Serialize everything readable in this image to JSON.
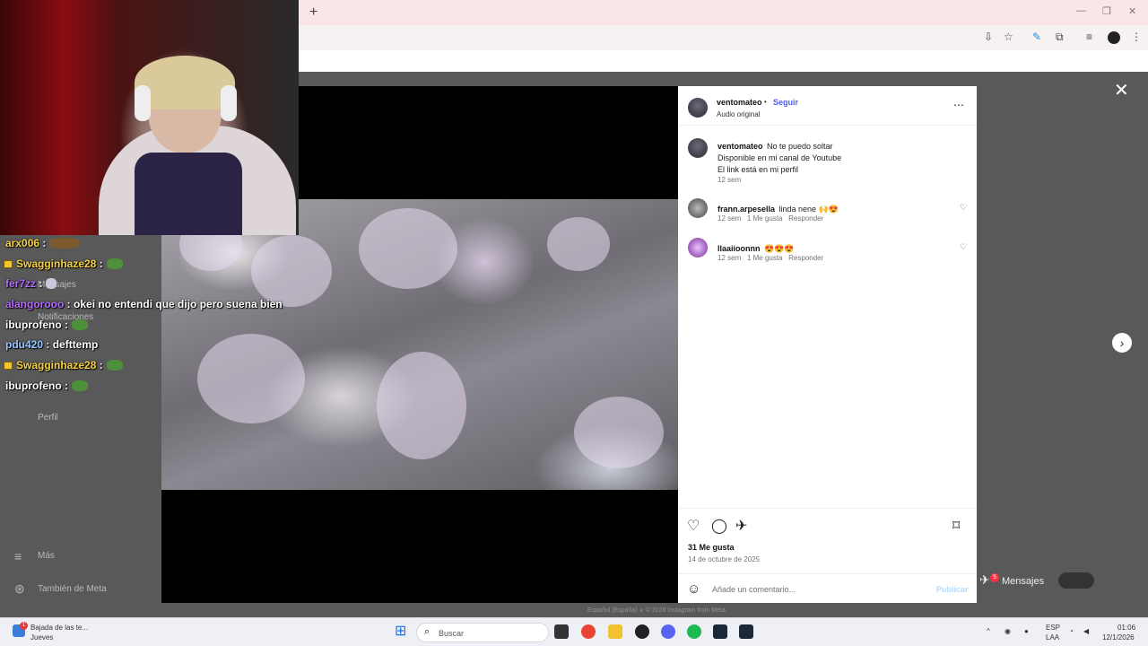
{
  "browser": {
    "new_tab": "+",
    "minimize": "—",
    "restore": "❐",
    "close": "✕"
  },
  "post": {
    "username": "ventomateo",
    "follow_label": "Seguir",
    "separator": "•",
    "audio": "Audio original",
    "caption_lines": [
      "No te puedo soltar",
      "Disponible en mi canal de Youtube",
      "El link está en mi perfil"
    ],
    "caption_time": "12 sem",
    "likes": "31 Me gusta",
    "date": "14 de octubre de 2025",
    "comment_placeholder": "Añade un comentario...",
    "publish_label": "Publicar"
  },
  "comments": [
    {
      "user": "frann.arpesella",
      "text": "linda nene 🙌😍",
      "time": "12 sem",
      "likes": "1 Me gusta",
      "reply": "Responder"
    },
    {
      "user": "llaaiioonnn",
      "text": "😍😍😍",
      "time": "12 sem",
      "likes": "1 Me gusta",
      "reply": "Responder"
    }
  ],
  "sidebar_ghost": {
    "mensajes": "Mensajes",
    "notificaciones": "Notificaciones",
    "perfil": "Perfil",
    "mas": "Más",
    "meta": "También de Meta"
  },
  "mensajes_pill": {
    "label": "Mensajes",
    "count": "5"
  },
  "footer_ghost": "Español (España) ∨    © 2026 Instagram from Meta",
  "chat": [
    {
      "user": "arx006",
      "sep": " :",
      "msg": "",
      "color": "#f5d142",
      "sub": false,
      "emote": "#7d5a2d"
    },
    {
      "user": "Swagginhaze28",
      "sep": " :",
      "msg": "",
      "color": "#f5d142",
      "sub": true,
      "emote": "#4d8f3a"
    },
    {
      "user": "fer7zz",
      "sep": " :",
      "msg": "",
      "color": "#b56cff",
      "sub": false,
      "emote": "#c9c9d9"
    },
    {
      "user": "alangorooo",
      "sep": " :",
      "msg": " okei no entendi que dijo pero suena bien",
      "color": "#b56cff",
      "sub": false,
      "emote": ""
    },
    {
      "user": "ibuprofeno",
      "sep": " :",
      "msg": "",
      "color": "#ffffff",
      "sub": false,
      "emote": "#4d8f3a"
    },
    {
      "user": "pdu420",
      "sep": " :",
      "msg": " defttemp",
      "color": "#9ac8ff",
      "sub": false,
      "emote": ""
    },
    {
      "user": "Swagginhaze28",
      "sep": " :",
      "msg": "",
      "color": "#f5d142",
      "sub": true,
      "emote": "#4d8f3a"
    },
    {
      "user": "ibuprofeno",
      "sep": " :",
      "msg": "",
      "color": "#ffffff",
      "sub": false,
      "emote": "#4d8f3a"
    }
  ],
  "taskbar": {
    "weather_title": "Bajada de las te...",
    "weather_day": "Jueves",
    "weather_badge": "1",
    "search_placeholder": "Buscar",
    "lang_top": "ESP",
    "lang_bottom": "LAA",
    "time": "01:06",
    "date": "12/1/2026"
  }
}
